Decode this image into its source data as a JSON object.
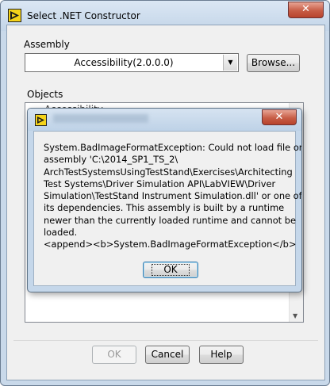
{
  "window": {
    "title": "Select .NET Constructor"
  },
  "assembly": {
    "label": "Assembly",
    "selected": "Accessibility(2.0.0.0)",
    "browse_label": "Browse..."
  },
  "objects": {
    "label": "Objects",
    "first_item": "Accessibility"
  },
  "dialog": {
    "message": "System.BadImageFormatException: Could not load file or\nassembly 'C:\\2014_SP1_TS_2\\\nArchTestSystemsUsingTestStand\\Exercises\\Architecting\nTest Systems\\Driver Simulation API\\LabVIEW\\Driver\nSimulation\\TestStand Instrument Simulation.dll' or one of\nits dependencies. This assembly is built by a runtime\nnewer than the currently loaded runtime and cannot be\nloaded.\n<append><b>System.BadImageFormatException</b>",
    "ok_label": "OK",
    "close_glyph": "✕"
  },
  "footer": {
    "ok_label": "OK",
    "cancel_label": "Cancel",
    "help_label": "Help"
  },
  "colors": {
    "window_frame": "#c9d9ea",
    "close_button": "#c75d46",
    "focus_border": "#3c7fb1"
  },
  "icons": {
    "app": "labview-icon",
    "close": "close-icon",
    "dropdown": "chevron-down-icon"
  }
}
